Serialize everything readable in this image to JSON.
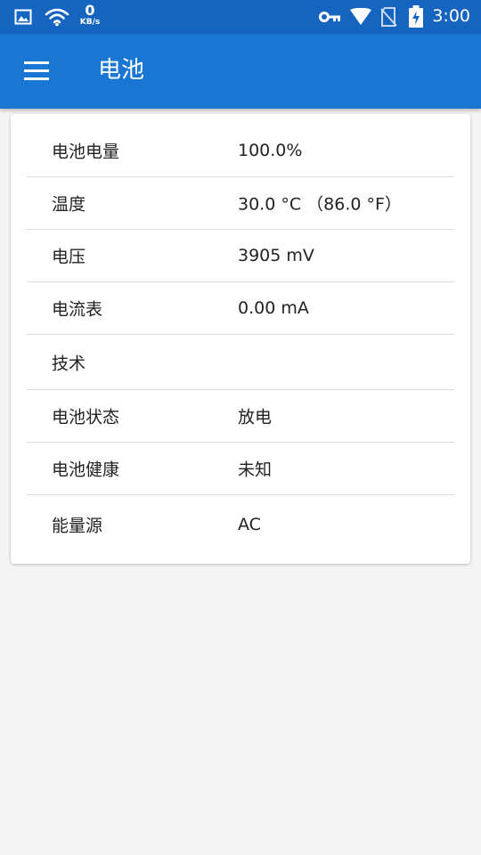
{
  "status_bar": {
    "net_speed_value": "0",
    "net_speed_unit": "KB/s",
    "time": "3:00",
    "icons": [
      "image-icon",
      "wifi-icon",
      "key-icon",
      "signal-icon",
      "no-sim-icon",
      "battery-charging-icon"
    ]
  },
  "app_bar": {
    "title": "电池",
    "menu_icon": "hamburger-menu-icon"
  },
  "battery_info": [
    {
      "label": "电池电量",
      "value": "100.0%"
    },
    {
      "label": "温度",
      "value": "30.0 °C （86.0 °F）"
    },
    {
      "label": "电压",
      "value": "3905 mV"
    },
    {
      "label": "电流表",
      "value": "0.00 mA"
    },
    {
      "label": "技术",
      "value": ""
    },
    {
      "label": "电池状态",
      "value": "放电"
    },
    {
      "label": "电池健康",
      "value": "未知"
    },
    {
      "label": "能量源",
      "value": "AC"
    }
  ],
  "colors": {
    "status_bar": "#1565c0",
    "app_bar": "#1976d2",
    "background": "#f4f4f4",
    "card": "#ffffff"
  }
}
